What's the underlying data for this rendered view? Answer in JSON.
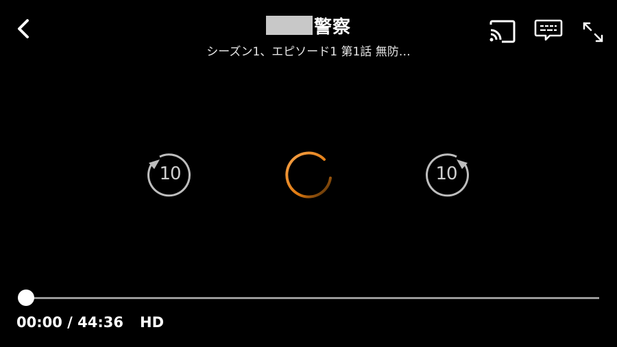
{
  "header": {
    "title": "警察",
    "subtitle": "シーズン1、エピソード1 第1話  無防…"
  },
  "icons": {
    "back": "chevron-left-icon",
    "cast": "cast-icon",
    "captions": "subtitles-icon",
    "fullscreen": "expand-icon",
    "rewind": "replay-10-icon",
    "forward": "forward-10-icon",
    "loading": "loading-spinner"
  },
  "controls": {
    "rewind_label": "10",
    "forward_label": "10"
  },
  "playback": {
    "current_time": "00:00",
    "separator": "/",
    "duration": "44:36",
    "quality": "HD",
    "progress_fraction": 0.0
  },
  "colors": {
    "background": "#000000",
    "spinner_accent": "#f08a1c",
    "track": "#9a9a9a",
    "control_gray": "#cfcfcf"
  }
}
